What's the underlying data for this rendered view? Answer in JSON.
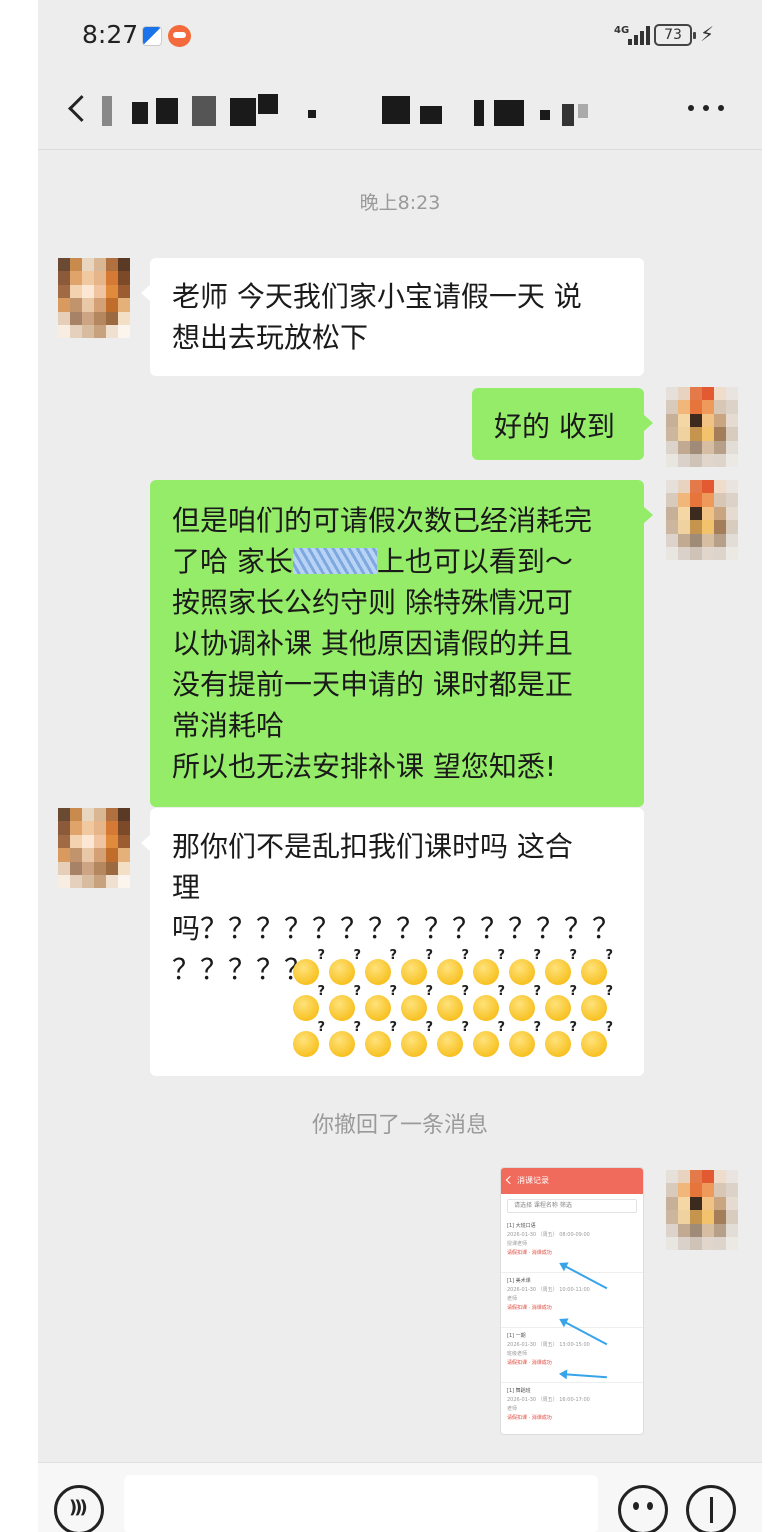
{
  "status_bar": {
    "time": "8:27",
    "network": "4G",
    "battery": "73"
  },
  "nav": {
    "title_redacted": true,
    "back_icon": "chevron-left-icon",
    "more_icon": "more-horizontal-icon"
  },
  "chat": {
    "timestamp": "晚上8:23",
    "messages": [
      {
        "side": "in",
        "text": "老师 今天我们家小宝请假一天  说\n想出去玩放松下"
      },
      {
        "side": "out",
        "text": "好的 收到"
      },
      {
        "side": "out",
        "text_before_redaction": "但是咱们的可请假次数已经消耗完\n了哈   家长",
        "text_after_redaction": "上也可以看到～\n按照家长公约守则   除特殊情况可\n以协调补课   其他原因请假的并且\n没有提前一天申请的   课时都是正\n常消耗哈\n 所以也无法安排补课  望您知悉!"
      },
      {
        "side": "in",
        "text": "那你们不是乱扣我们课时吗 这合\n理\n吗？？？？？？？？？？？？？？？\n？？？？？ ",
        "emoji_count": 27
      }
    ],
    "recall_notice": "你撤回了一条消息",
    "image_message": {
      "header": "消课记录",
      "search": "请选择 课程名称 筛选",
      "entries": [
        {
          "name": "[1] 大班口语",
          "date": "2026-01-30 （周五） 08:00-09:00",
          "teacher": "授课老师",
          "status": "请假扣课 · 消课成功"
        },
        {
          "name": "[1] 美术课",
          "date": "2026-01-30 （周五） 10:00-11:00",
          "teacher": "老师",
          "status": "请假扣课 · 消课成功"
        },
        {
          "name": "[1] 一期",
          "date": "2026-01-30 （周五） 13:00-15:00",
          "teacher": "班级老师",
          "status": "请假扣课 · 消课成功"
        },
        {
          "name": "[1] 舞蹈班",
          "date": "2026-01-30 （周五） 16:00-17:00",
          "teacher": "老师",
          "status": "请假扣课 · 消课成功"
        }
      ]
    }
  },
  "input_bar": {
    "placeholder": "",
    "voice_icon": "voice-icon",
    "emoji_icon": "emoji-icon",
    "plus_icon": "plus-icon"
  },
  "colors": {
    "outgoing_bubble": "#95ec69",
    "incoming_bubble": "#ffffff",
    "background": "#ededed",
    "arrow": "#37a3e8"
  }
}
